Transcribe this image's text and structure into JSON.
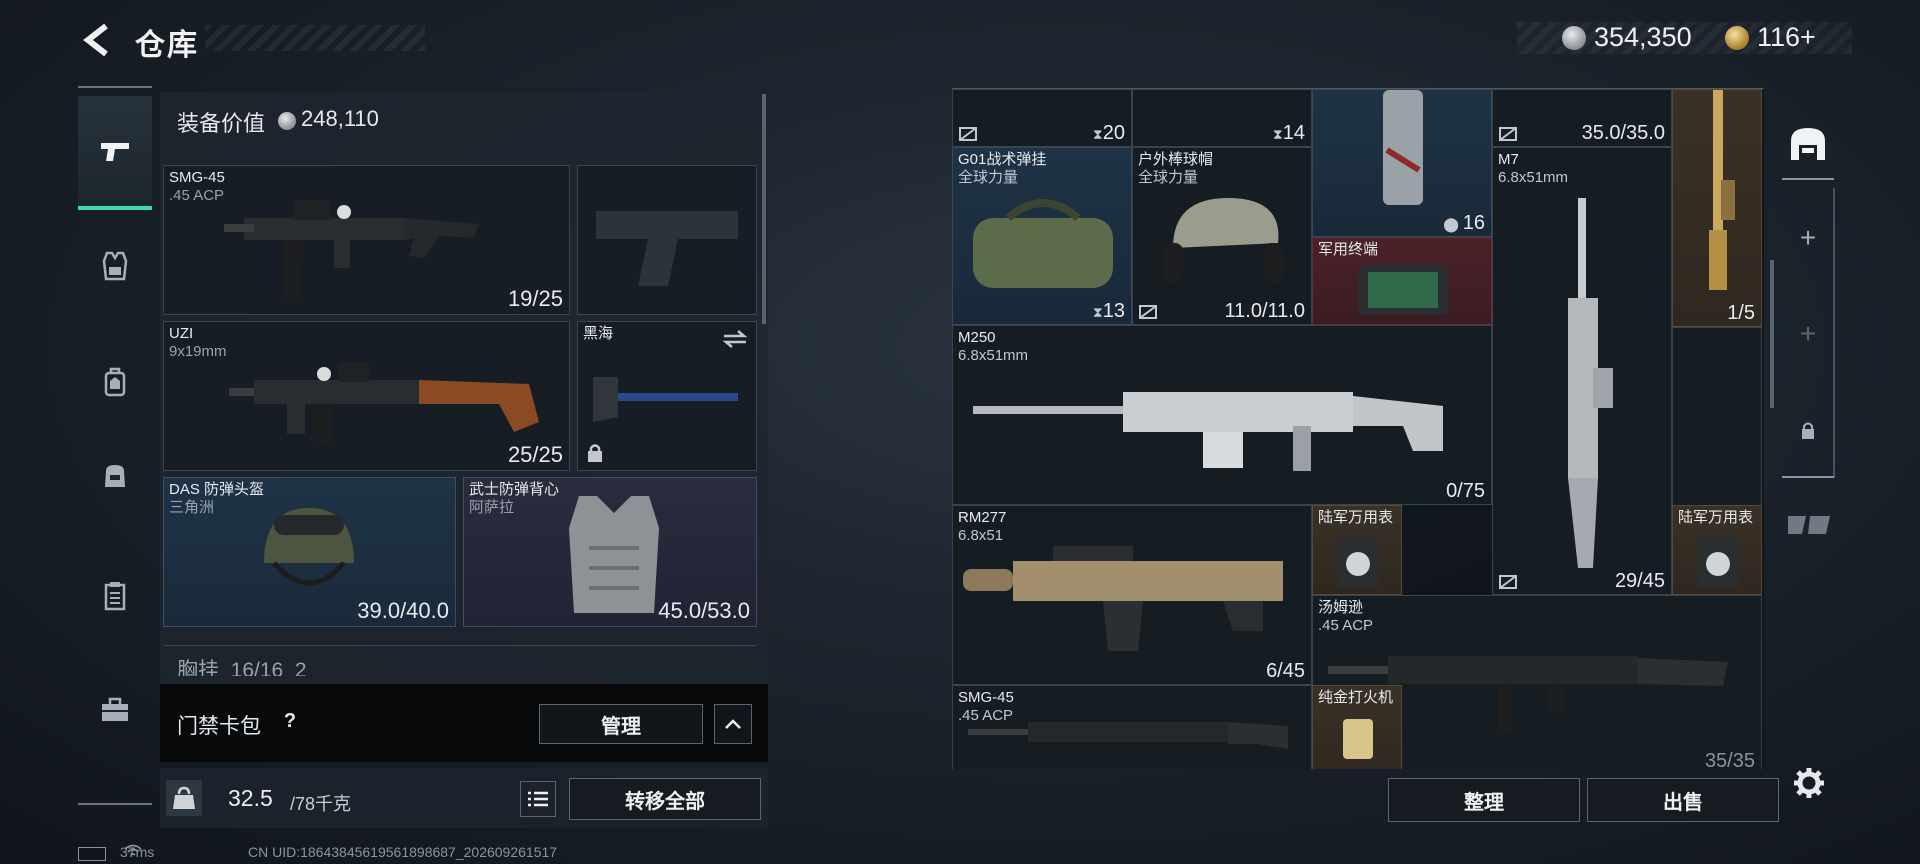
{
  "header": {
    "title": "仓库",
    "currency_silver": "354,350",
    "currency_gold": "116+"
  },
  "rail": {
    "items": [
      "pistol-icon",
      "vest-icon",
      "backpack-icon",
      "bag-icon",
      "clipboard-icon",
      "toolbox-icon"
    ],
    "active": 0
  },
  "loadout": {
    "value_label": "装备价值",
    "value": "248,110",
    "slots": [
      {
        "name": "SMG-45",
        "sub": ".45 ACP",
        "count": "19/25"
      },
      {
        "name": "",
        "sub": "",
        "count": ""
      },
      {
        "name": "UZI",
        "sub": "9x19mm",
        "count": "25/25"
      },
      {
        "name": "黑海",
        "sub": "",
        "count": ""
      },
      {
        "name": "DAS 防弹头盔",
        "sub": "三角洲",
        "count": "39.0/40.0"
      },
      {
        "name": "武士防弹背心",
        "sub": "阿萨拉",
        "count": "45.0/53.0"
      }
    ],
    "partial": "胸挂  16/16  2"
  },
  "door_card": {
    "label": "门禁卡包",
    "help": "?",
    "manage": "管理"
  },
  "weight": {
    "current": "32.5",
    "max": "/78千克",
    "unit_icon": "KG",
    "transfer_all": "转移全部"
  },
  "status": {
    "ping": "37ms",
    "uid": "CN UID:18643845619561898687_202609261517"
  },
  "storage": {
    "top_row": [
      {
        "count": "20"
      },
      {
        "count": "14"
      },
      {
        "count": ""
      },
      {
        "count": "35.0/35.0"
      }
    ],
    "items": {
      "bag": {
        "name": "G01战术弹挂",
        "sub": "全球力量",
        "count": "13"
      },
      "cap": {
        "name": "户外棒球帽",
        "sub": "全球力量",
        "count": "11.0/11.0"
      },
      "spray": {
        "count": "16"
      },
      "terminal": {
        "name": "军用终端"
      },
      "m7": {
        "name": "M7",
        "sub": "6.8x51mm",
        "count": "29/45"
      },
      "sniper": {
        "count": "1/5"
      },
      "m250": {
        "name": "M250",
        "sub": "6.8x51mm",
        "count": "0/75"
      },
      "rm277": {
        "name": "RM277",
        "sub": "6.8x51",
        "count": "6/45"
      },
      "watch1": {
        "name": "陆军万用表"
      },
      "watch2": {
        "name": "陆军万用表"
      },
      "thompson": {
        "name": "汤姆逊",
        "sub": ".45 ACP",
        "count": "35/35"
      },
      "smg45": {
        "name": "SMG-45",
        "sub": ".45 ACP"
      },
      "lighter": {
        "name": "纯金打火机"
      }
    }
  },
  "actions": {
    "sort": "整理",
    "sell": "出售"
  },
  "colors": {
    "accent": "#3fd6b5",
    "blue_tier": "#1e3346",
    "purple_tier": "#2a2c3e",
    "red_tier": "#4a2228",
    "gold_tier": "#3a3126"
  }
}
